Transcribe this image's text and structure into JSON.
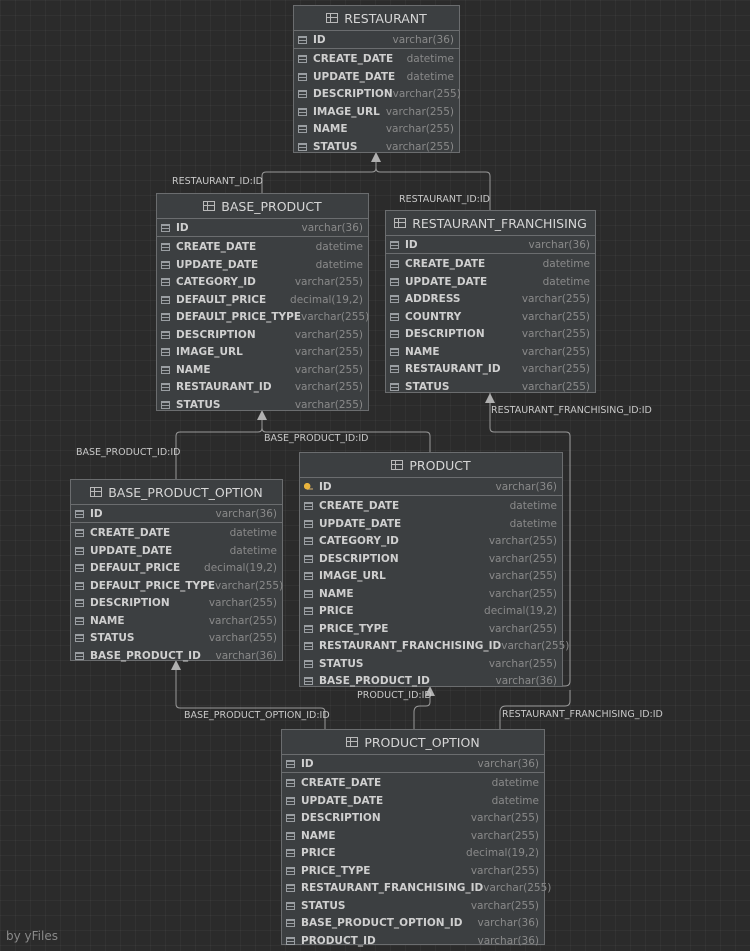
{
  "tables": [
    {
      "id": "restaurant",
      "name": "RESTAURANT",
      "columns": [
        {
          "name": "ID",
          "type": "varchar(36)",
          "pk": true
        },
        {
          "name": "CREATE_DATE",
          "type": "datetime"
        },
        {
          "name": "UPDATE_DATE",
          "type": "datetime"
        },
        {
          "name": "DESCRIPTION",
          "type": "varchar(255)"
        },
        {
          "name": "IMAGE_URL",
          "type": "varchar(255)"
        },
        {
          "name": "NAME",
          "type": "varchar(255)"
        },
        {
          "name": "STATUS",
          "type": "varchar(255)"
        }
      ]
    },
    {
      "id": "base-product",
      "name": "BASE_PRODUCT",
      "columns": [
        {
          "name": "ID",
          "type": "varchar(36)",
          "pk": true
        },
        {
          "name": "CREATE_DATE",
          "type": "datetime"
        },
        {
          "name": "UPDATE_DATE",
          "type": "datetime"
        },
        {
          "name": "CATEGORY_ID",
          "type": "varchar(255)"
        },
        {
          "name": "DEFAULT_PRICE",
          "type": "decimal(19,2)"
        },
        {
          "name": "DEFAULT_PRICE_TYPE",
          "type": "varchar(255)"
        },
        {
          "name": "DESCRIPTION",
          "type": "varchar(255)"
        },
        {
          "name": "IMAGE_URL",
          "type": "varchar(255)"
        },
        {
          "name": "NAME",
          "type": "varchar(255)"
        },
        {
          "name": "RESTAURANT_ID",
          "type": "varchar(255)"
        },
        {
          "name": "STATUS",
          "type": "varchar(255)"
        }
      ]
    },
    {
      "id": "restaurant-franchising",
      "name": "RESTAURANT_FRANCHISING",
      "columns": [
        {
          "name": "ID",
          "type": "varchar(36)",
          "pk": true
        },
        {
          "name": "CREATE_DATE",
          "type": "datetime"
        },
        {
          "name": "UPDATE_DATE",
          "type": "datetime"
        },
        {
          "name": "ADDRESS",
          "type": "varchar(255)"
        },
        {
          "name": "COUNTRY",
          "type": "varchar(255)"
        },
        {
          "name": "DESCRIPTION",
          "type": "varchar(255)"
        },
        {
          "name": "NAME",
          "type": "varchar(255)"
        },
        {
          "name": "RESTAURANT_ID",
          "type": "varchar(255)"
        },
        {
          "name": "STATUS",
          "type": "varchar(255)"
        }
      ]
    },
    {
      "id": "base-product-option",
      "name": "BASE_PRODUCT_OPTION",
      "columns": [
        {
          "name": "ID",
          "type": "varchar(36)",
          "pk": true
        },
        {
          "name": "CREATE_DATE",
          "type": "datetime"
        },
        {
          "name": "UPDATE_DATE",
          "type": "datetime"
        },
        {
          "name": "DEFAULT_PRICE",
          "type": "decimal(19,2)"
        },
        {
          "name": "DEFAULT_PRICE_TYPE",
          "type": "varchar(255)"
        },
        {
          "name": "DESCRIPTION",
          "type": "varchar(255)"
        },
        {
          "name": "NAME",
          "type": "varchar(255)"
        },
        {
          "name": "STATUS",
          "type": "varchar(255)"
        },
        {
          "name": "BASE_PRODUCT_ID",
          "type": "varchar(36)"
        }
      ]
    },
    {
      "id": "product",
      "name": "PRODUCT",
      "columns": [
        {
          "name": "ID",
          "type": "varchar(36)",
          "pk": true,
          "icon": "key"
        },
        {
          "name": "CREATE_DATE",
          "type": "datetime"
        },
        {
          "name": "UPDATE_DATE",
          "type": "datetime"
        },
        {
          "name": "CATEGORY_ID",
          "type": "varchar(255)"
        },
        {
          "name": "DESCRIPTION",
          "type": "varchar(255)"
        },
        {
          "name": "IMAGE_URL",
          "type": "varchar(255)"
        },
        {
          "name": "NAME",
          "type": "varchar(255)"
        },
        {
          "name": "PRICE",
          "type": "decimal(19,2)"
        },
        {
          "name": "PRICE_TYPE",
          "type": "varchar(255)"
        },
        {
          "name": "RESTAURANT_FRANCHISING_ID",
          "type": "varchar(255)"
        },
        {
          "name": "STATUS",
          "type": "varchar(255)"
        },
        {
          "name": "BASE_PRODUCT_ID",
          "type": "varchar(36)"
        }
      ]
    },
    {
      "id": "product-option",
      "name": "PRODUCT_OPTION",
      "columns": [
        {
          "name": "ID",
          "type": "varchar(36)",
          "pk": true
        },
        {
          "name": "CREATE_DATE",
          "type": "datetime"
        },
        {
          "name": "UPDATE_DATE",
          "type": "datetime"
        },
        {
          "name": "DESCRIPTION",
          "type": "varchar(255)"
        },
        {
          "name": "NAME",
          "type": "varchar(255)"
        },
        {
          "name": "PRICE",
          "type": "decimal(19,2)"
        },
        {
          "name": "PRICE_TYPE",
          "type": "varchar(255)"
        },
        {
          "name": "RESTAURANT_FRANCHISING_ID",
          "type": "varchar(255)"
        },
        {
          "name": "STATUS",
          "type": "varchar(255)"
        },
        {
          "name": "BASE_PRODUCT_OPTION_ID",
          "type": "varchar(36)"
        },
        {
          "name": "PRODUCT_ID",
          "type": "varchar(36)"
        }
      ]
    }
  ],
  "edges": [
    {
      "id": "bp-restaurant",
      "label": "RESTAURANT_ID:ID"
    },
    {
      "id": "rf-restaurant",
      "label": "RESTAURANT_ID:ID"
    },
    {
      "id": "bpo-bp",
      "label": "BASE_PRODUCT_ID:ID"
    },
    {
      "id": "product-bp",
      "label": "BASE_PRODUCT_ID:ID"
    },
    {
      "id": "product-rf",
      "label": "RESTAURANT_FRANCHISING_ID:ID"
    },
    {
      "id": "po-bpo",
      "label": "BASE_PRODUCT_OPTION_ID:ID"
    },
    {
      "id": "po-product",
      "label": "PRODUCT_ID:ID"
    },
    {
      "id": "po-rf",
      "label": "RESTAURANT_FRANCHISING_ID:ID"
    }
  ],
  "watermark": "by yFiles",
  "colors": {
    "background": "#2b2b2b",
    "table": "#3c3f41",
    "edge": "#9a9a9a"
  }
}
